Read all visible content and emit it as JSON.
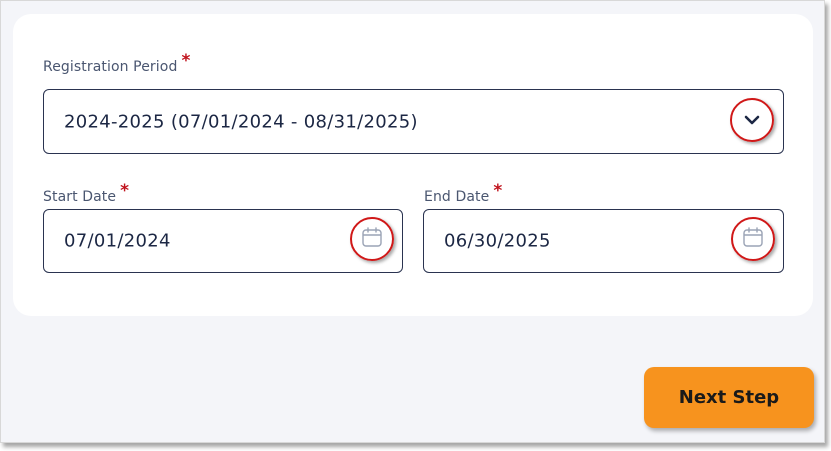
{
  "form": {
    "registration_period": {
      "label": "Registration Period",
      "required_marker": "*",
      "value": "2024-2025 (07/01/2024 - 08/31/2025)",
      "icon": "chevron-down-icon"
    },
    "start_date": {
      "label": "Start Date",
      "required_marker": "*",
      "value": "07/01/2024",
      "icon": "calendar-icon"
    },
    "end_date": {
      "label": "End Date",
      "required_marker": "*",
      "value": "06/30/2025",
      "icon": "calendar-icon"
    }
  },
  "actions": {
    "next_label": "Next Step"
  },
  "colors": {
    "accent": "#f7931e",
    "required": "#c0131d",
    "highlight_circle": "#d01818",
    "field_border": "#2a3350",
    "text": "#1c2744",
    "label": "#4a5670"
  }
}
